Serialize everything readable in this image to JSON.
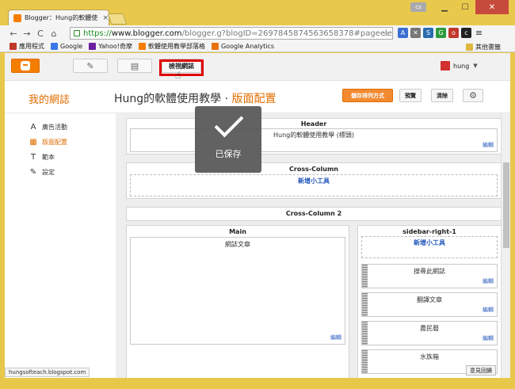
{
  "browser": {
    "tab_title": "Blogger：Hung的軟體使",
    "tab_close": "×",
    "window_user": "cs",
    "url_scheme": "https://",
    "url_host": "www.blogger.com",
    "url_rest": "/blogger.g?blogID=2697845874563658378#pageelem",
    "bookmarks": [
      {
        "label": "應用程式",
        "color": "#c0392b"
      },
      {
        "label": "Google",
        "color": "#3b78e7"
      },
      {
        "label": "Yahoo!奇摩",
        "color": "#6b1fa0"
      },
      {
        "label": "軟體使用教學部落格",
        "color": "#f57d00"
      },
      {
        "label": "Google Analytics",
        "color": "#e8710a"
      }
    ],
    "other_bookmarks": "其他書籤",
    "status_url": "hungsofteach.blogspot.com"
  },
  "blogger_header": {
    "view_blog_label": "檢視網誌",
    "username": "hung"
  },
  "subheader": {
    "blog_name": "我的網誌",
    "blog_title": "Hung的軟體使用教學",
    "separator": " · ",
    "section_title": "版面配置",
    "save_arrangement": "儲存排列方式",
    "preview": "預覽",
    "clear": "清除"
  },
  "sidenav": {
    "items": [
      {
        "label": "廣告活動",
        "icon": "A"
      },
      {
        "label": "版面配置",
        "icon": "▦"
      },
      {
        "label": "範本",
        "icon": "T"
      },
      {
        "label": "設定",
        "icon": "✎"
      }
    ]
  },
  "layout": {
    "header_section": "Header",
    "header_gadget": "Hung的軟體使用教學 (標頭)",
    "edit_label": "編輯",
    "cross_column": "Cross-Column",
    "add_gadget": "新增小工具",
    "cross_column_2": "Cross-Column 2",
    "main_section": "Main",
    "main_gadget": "網誌文章",
    "sidebar_section": "sidebar-right-1",
    "sidebar_gadgets": [
      "搜尋此網誌",
      "翻譯文章",
      "農民曆",
      "水族箱"
    ]
  },
  "toast": {
    "message": "已保存"
  },
  "feedback": "意見回饋"
}
